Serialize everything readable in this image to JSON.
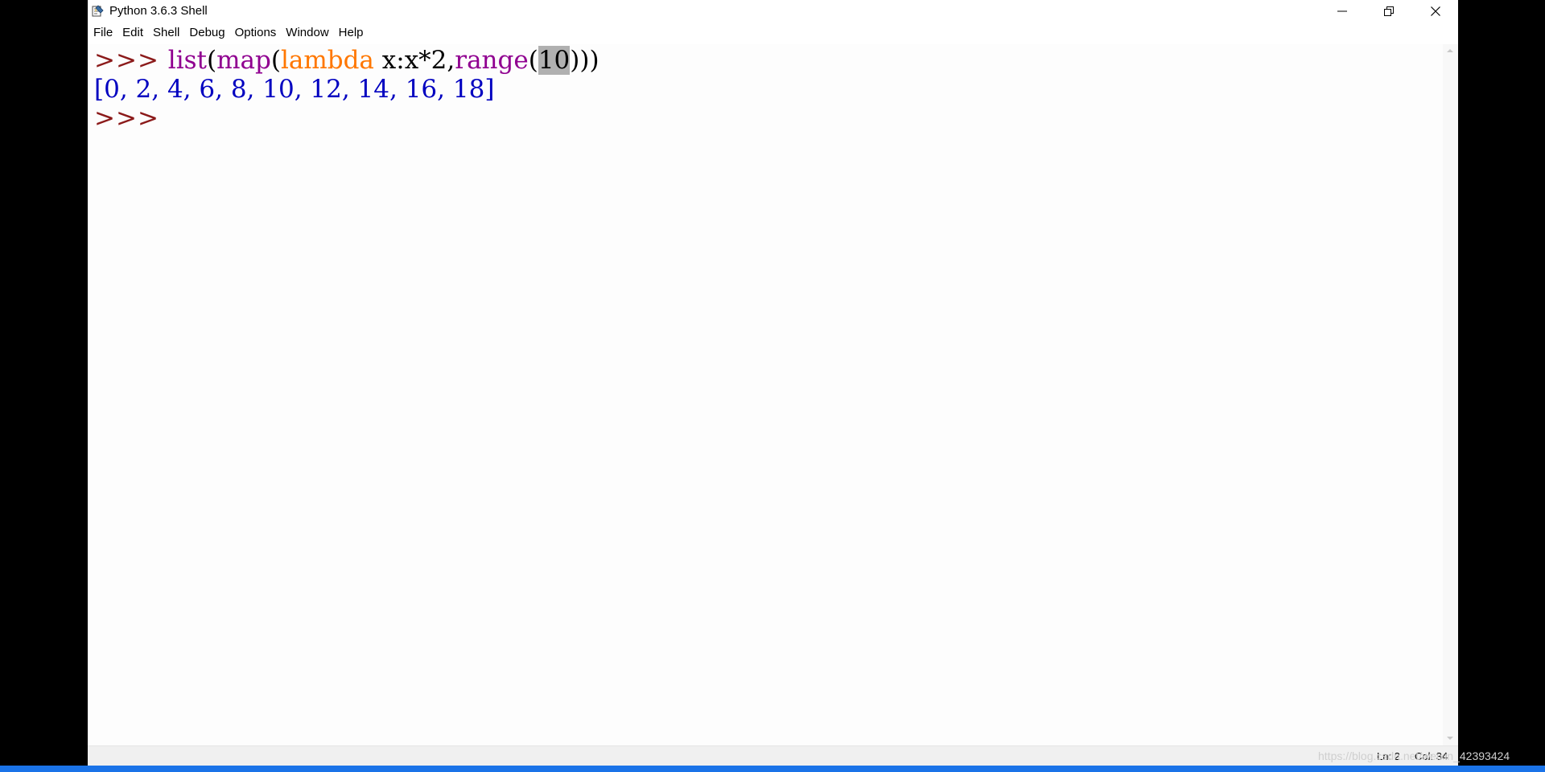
{
  "window": {
    "title": "Python 3.6.3 Shell"
  },
  "menubar": {
    "items": [
      "File",
      "Edit",
      "Shell",
      "Debug",
      "Options",
      "Window",
      "Help"
    ]
  },
  "shell": {
    "line1": {
      "prompt": ">>> ",
      "fn_list": "list",
      "p1": "(",
      "fn_map": "map",
      "p2": "(",
      "kw_lambda": "lambda",
      "expr": " x:x*2,",
      "fn_range": "range",
      "p3": "(",
      "arg_selected": "10",
      "close": ")))"
    },
    "output": "[0, 2, 4, 6, 8, 10, 12, 14, 16, 18]",
    "line3": {
      "prompt": ">>> "
    }
  },
  "statusbar": {
    "line": "Ln: 2",
    "col": "Col: 34"
  },
  "watermark": {
    "text": "https://blog.csdn.net/weixin_42393424"
  },
  "colors": {
    "prompt": "#8b1a1a",
    "builtin": "#900090",
    "keyword": "#ff7700",
    "output": "#0000c0"
  }
}
